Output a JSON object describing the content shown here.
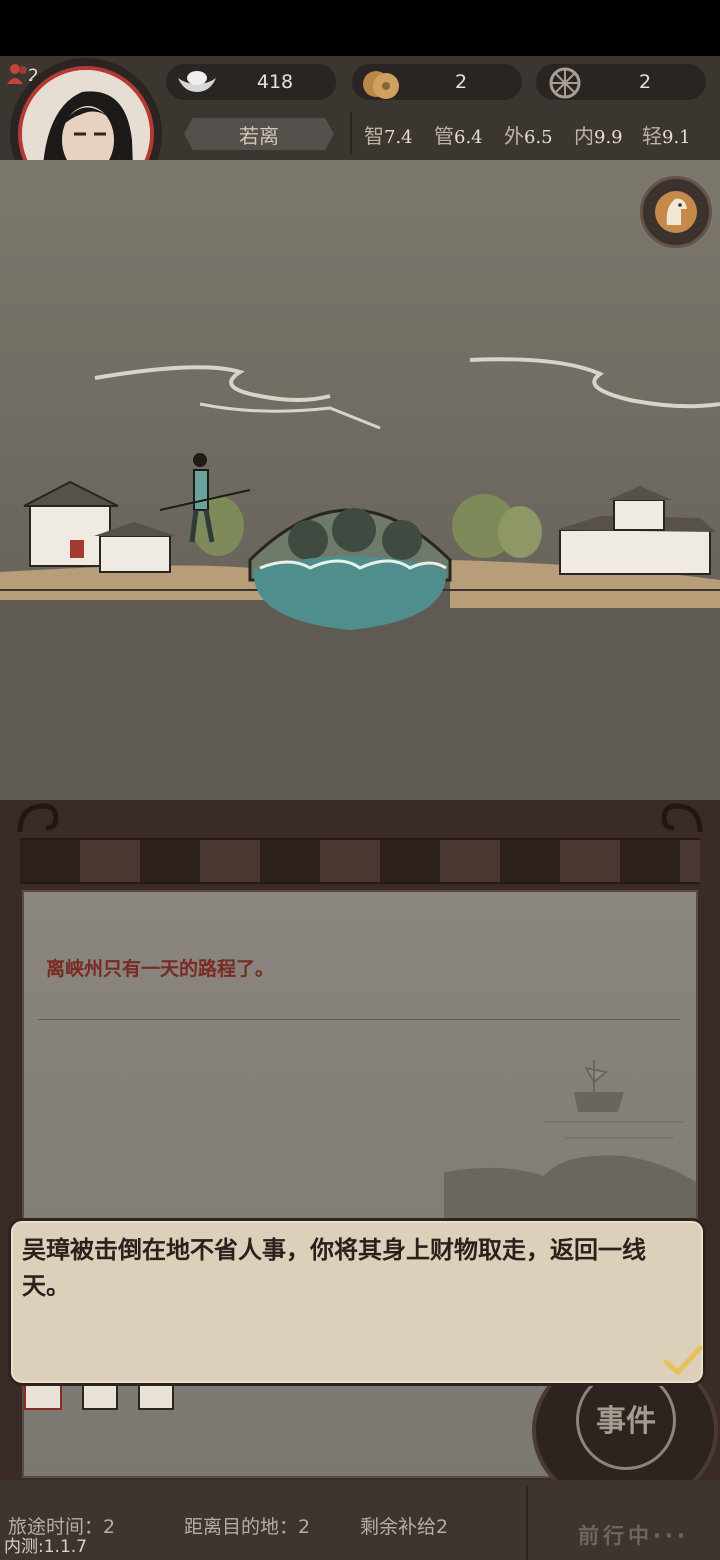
{
  "player": {
    "name": "若离",
    "party_count": "2"
  },
  "resources": {
    "silver": "418",
    "coins": "2",
    "wheel": "2"
  },
  "stats": [
    {
      "label": "智",
      "value": "7.4"
    },
    {
      "label": "管",
      "value": "6.4"
    },
    {
      "label": "外",
      "value": "6.5"
    },
    {
      "label": "内",
      "value": "9.9"
    },
    {
      "label": "轻",
      "value": "9.1"
    }
  ],
  "journal": {
    "line": "离峡州只有一天的路程了。"
  },
  "dialog": {
    "text": "吴璋被击倒在地不省人事，你将其身上财物取走，返回一线天。"
  },
  "event_button": {
    "label": "事件"
  },
  "footer": {
    "travel_time": "旅途时间：2",
    "distance": "距离目的地：2",
    "supplies": "剩余补给2",
    "version": "内测:1.1.7",
    "status": "前行中···"
  },
  "colors": {
    "accent_red": "#b33a35",
    "panel_brown": "#3b2b26",
    "dialog_bg": "#ddd0bb",
    "check": "#e7c15a"
  }
}
